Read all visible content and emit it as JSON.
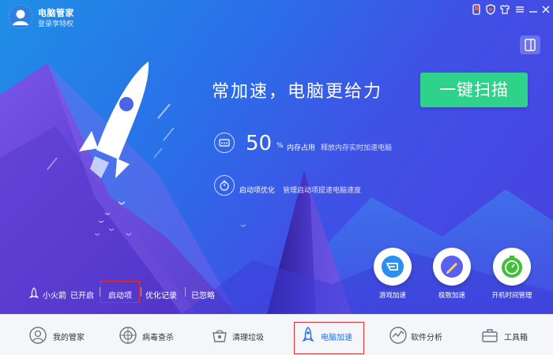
{
  "window": {
    "app_name": "电脑管家",
    "login_text": "登录享特权"
  },
  "hero": {
    "slogan": "常加速，电脑更给力",
    "scan_button": "一键扫描",
    "memory": {
      "value": "50",
      "unit": "%",
      "label": "内存占用",
      "description": "释放内存实时加速电脑"
    },
    "startup": {
      "label": "启动项优化",
      "description": "管理启动项提速电脑速度"
    }
  },
  "bottom_links": {
    "rocket_label": "小火箭",
    "rocket_status": "已开启",
    "startup": "启动项",
    "history": "优化记录",
    "ignored": "已忽略"
  },
  "tools": [
    {
      "label": "游戏加速",
      "icon": "game-boost-icon"
    },
    {
      "label": "极致加速",
      "icon": "extreme-boost-icon"
    },
    {
      "label": "开机时间管理",
      "icon": "boot-time-icon"
    }
  ],
  "tabs": [
    {
      "label": "我的管家",
      "icon": "butler-icon"
    },
    {
      "label": "病毒查杀",
      "icon": "virus-scan-icon"
    },
    {
      "label": "清理垃圾",
      "icon": "cleanup-icon"
    },
    {
      "label": "电脑加速",
      "icon": "rocket-icon",
      "active": true
    },
    {
      "label": "软件分析",
      "icon": "software-analysis-icon"
    },
    {
      "label": "工具箱",
      "icon": "toolbox-icon"
    }
  ],
  "colors": {
    "hero_start": "#1f8fe6",
    "hero_end": "#4b3fe0",
    "scan_button": "#2fd28a",
    "active_tab": "#2a6fe8",
    "highlight_box": "#e32f2f"
  }
}
